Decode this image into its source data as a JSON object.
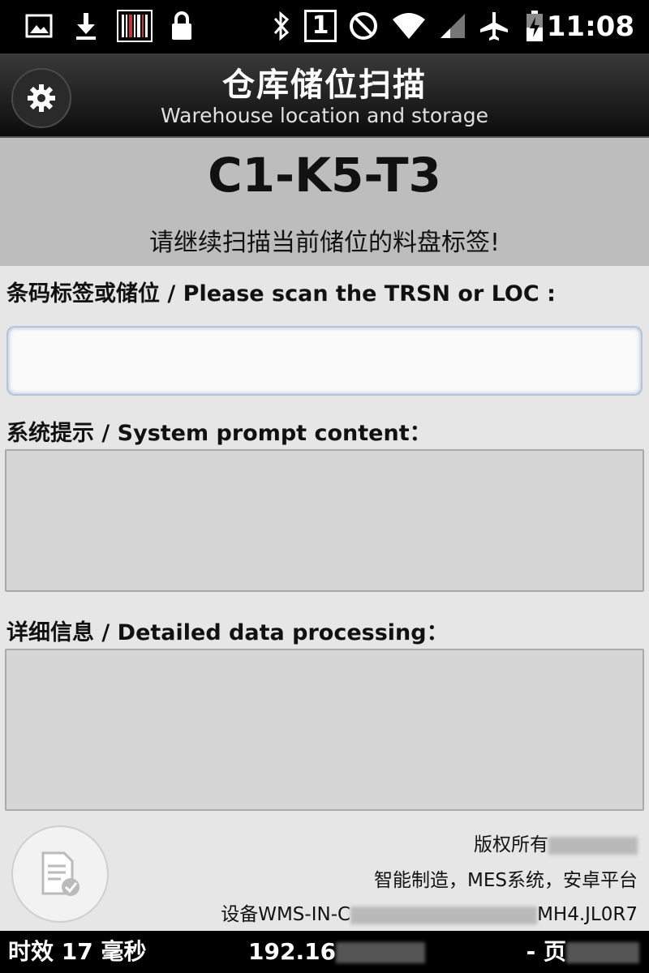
{
  "status_bar": {
    "time": "11:08",
    "sim_slot": "1",
    "icons": [
      "image-icon",
      "download-icon",
      "barcode-icon",
      "lock-icon",
      "bluetooth-icon",
      "sim-icon",
      "do-not-disturb-icon",
      "wifi-icon",
      "airplane-icon",
      "battery-charging-icon"
    ]
  },
  "header": {
    "title": "仓库储位扫描",
    "subtitle": "Warehouse location and storage",
    "settings_icon": "gear-icon"
  },
  "location": {
    "code": "C1-K5-T3",
    "hint": "请继续扫描当前储位的料盘标签!"
  },
  "form": {
    "scan_label": "条码标签或储位 / Please scan the TRSN or LOC :",
    "scan_value": "",
    "prompt_label": "系统提示 / System prompt content：",
    "prompt_content": "",
    "detail_label": "详细信息 / Detailed data processing：",
    "detail_content": ""
  },
  "footer": {
    "copyright": "版权所有",
    "platform": "智能制造，MES系统，安卓平台",
    "device_prefix": "设备WMS-IN-C",
    "device_suffix": "MH4.JL0R7",
    "doc_icon": "document-check-icon"
  },
  "bottom_bar": {
    "latency": "时效 17 毫秒",
    "ip": "192.16",
    "right_text": "- 页"
  },
  "colors": {
    "status_bar": "#000000",
    "header": "#1a1a1a",
    "location_panel": "#bdbdbd",
    "background": "#e6e6e6"
  }
}
